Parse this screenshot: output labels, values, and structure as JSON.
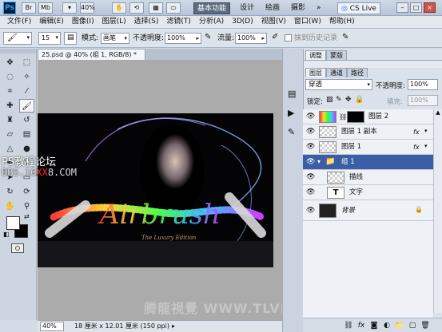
{
  "titlebar": {
    "app_logo": "Ps",
    "workspaces": [
      "基本功能",
      "设计",
      "绘画",
      "摄影"
    ],
    "overflow": "»",
    "cslive": "CS Live",
    "controls": [
      "–",
      "□",
      "×"
    ]
  },
  "menu": [
    "文件(F)",
    "编辑(E)",
    "图像(I)",
    "图层(L)",
    "选择(S)",
    "滤镜(T)",
    "分析(A)",
    "3D(D)",
    "视图(V)",
    "窗口(W)",
    "帮助(H)"
  ],
  "options": {
    "brush_size": "15",
    "mode_label": "模式:",
    "mode_value": "画笔",
    "opacity_label": "不透明度:",
    "opacity_value": "100%",
    "flow_label": "流量:",
    "flow_value": "100%",
    "history_label": "抹到历史记录"
  },
  "document": {
    "tab_title": "25.psd @ 40% (组 1, RGB/8) *",
    "close": "×",
    "zoom": "40%",
    "info": "18 厘米 x 12.01 厘米 (150 ppi)",
    "canvas_text": "Airbrush",
    "canvas_subtext": "The Luxury Edition"
  },
  "watermarks": {
    "forum": "PS教程论坛",
    "bbs_prefix": "BBS.16",
    "bbs_red": "XX",
    "bbs_suffix": "8.COM",
    "tlvi": "腾龍視覺 WWW.TLVI.NET"
  },
  "panels": {
    "tabs_top": [
      "调整",
      "蒙版"
    ],
    "tabs_layers": [
      "图层",
      "通道",
      "路径"
    ],
    "blend_mode": "穿透",
    "opacity_label": "不透明度:",
    "opacity_value": "100%",
    "lock_label": "锁定:",
    "fill_label": "填充:",
    "fill_value": "100%",
    "layers": [
      {
        "name": "图层 2"
      },
      {
        "name": "图层 1 副本",
        "fx": "fx"
      },
      {
        "name": "图层 1",
        "fx": "fx"
      },
      {
        "name": "组 1"
      },
      {
        "name": "描线"
      },
      {
        "name": "文字",
        "type": "T"
      },
      {
        "name": "背景"
      }
    ]
  },
  "colors": {
    "selected_layer": "#3b5ea6",
    "accent_red": "#ff2a2a"
  }
}
